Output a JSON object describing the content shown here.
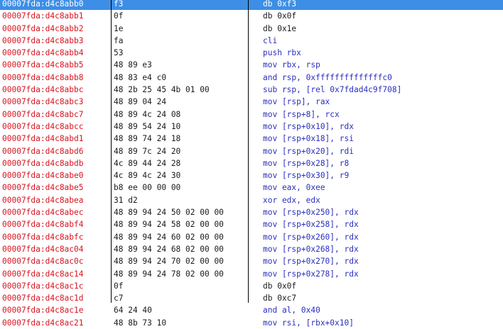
{
  "colors": {
    "address": "#d8131f",
    "bytes": "#1a1a1a",
    "instruction": "#2a2fbf",
    "data_directive": "#1a1a1a",
    "selection": "#3d8ee6"
  },
  "selected_index": 0,
  "rows": [
    {
      "address": "00007fda:d4c8abb0",
      "bytes": "f3",
      "instruction": "db 0xf3",
      "kind": "data"
    },
    {
      "address": "00007fda:d4c8abb1",
      "bytes": "0f",
      "instruction": "db 0x0f",
      "kind": "data"
    },
    {
      "address": "00007fda:d4c8abb2",
      "bytes": "1e",
      "instruction": "db 0x1e",
      "kind": "data"
    },
    {
      "address": "00007fda:d4c8abb3",
      "bytes": "fa",
      "instruction": "cli",
      "kind": "code"
    },
    {
      "address": "00007fda:d4c8abb4",
      "bytes": "53",
      "instruction": "push rbx",
      "kind": "code"
    },
    {
      "address": "00007fda:d4c8abb5",
      "bytes": "48 89 e3",
      "instruction": "mov rbx, rsp",
      "kind": "code"
    },
    {
      "address": "00007fda:d4c8abb8",
      "bytes": "48 83 e4 c0",
      "instruction": "and rsp, 0xffffffffffffffc0",
      "kind": "code"
    },
    {
      "address": "00007fda:d4c8abbc",
      "bytes": "48 2b 25 45 4b 01 00",
      "instruction": "sub rsp, [rel 0x7fdad4c9f708]",
      "kind": "code"
    },
    {
      "address": "00007fda:d4c8abc3",
      "bytes": "48 89 04 24",
      "instruction": "mov [rsp], rax",
      "kind": "code"
    },
    {
      "address": "00007fda:d4c8abc7",
      "bytes": "48 89 4c 24 08",
      "instruction": "mov [rsp+8], rcx",
      "kind": "code"
    },
    {
      "address": "00007fda:d4c8abcc",
      "bytes": "48 89 54 24 10",
      "instruction": "mov [rsp+0x10], rdx",
      "kind": "code"
    },
    {
      "address": "00007fda:d4c8abd1",
      "bytes": "48 89 74 24 18",
      "instruction": "mov [rsp+0x18], rsi",
      "kind": "code"
    },
    {
      "address": "00007fda:d4c8abd6",
      "bytes": "48 89 7c 24 20",
      "instruction": "mov [rsp+0x20], rdi",
      "kind": "code"
    },
    {
      "address": "00007fda:d4c8abdb",
      "bytes": "4c 89 44 24 28",
      "instruction": "mov [rsp+0x28], r8",
      "kind": "code"
    },
    {
      "address": "00007fda:d4c8abe0",
      "bytes": "4c 89 4c 24 30",
      "instruction": "mov [rsp+0x30], r9",
      "kind": "code"
    },
    {
      "address": "00007fda:d4c8abe5",
      "bytes": "b8 ee 00 00 00",
      "instruction": "mov eax, 0xee",
      "kind": "code"
    },
    {
      "address": "00007fda:d4c8abea",
      "bytes": "31 d2",
      "instruction": "xor edx, edx",
      "kind": "code"
    },
    {
      "address": "00007fda:d4c8abec",
      "bytes": "48 89 94 24 50 02 00 00",
      "instruction": "mov [rsp+0x250], rdx",
      "kind": "code"
    },
    {
      "address": "00007fda:d4c8abf4",
      "bytes": "48 89 94 24 58 02 00 00",
      "instruction": "mov [rsp+0x258], rdx",
      "kind": "code"
    },
    {
      "address": "00007fda:d4c8abfc",
      "bytes": "48 89 94 24 60 02 00 00",
      "instruction": "mov [rsp+0x260], rdx",
      "kind": "code"
    },
    {
      "address": "00007fda:d4c8ac04",
      "bytes": "48 89 94 24 68 02 00 00",
      "instruction": "mov [rsp+0x268], rdx",
      "kind": "code"
    },
    {
      "address": "00007fda:d4c8ac0c",
      "bytes": "48 89 94 24 70 02 00 00",
      "instruction": "mov [rsp+0x270], rdx",
      "kind": "code"
    },
    {
      "address": "00007fda:d4c8ac14",
      "bytes": "48 89 94 24 78 02 00 00",
      "instruction": "mov [rsp+0x278], rdx",
      "kind": "code"
    },
    {
      "address": "00007fda:d4c8ac1c",
      "bytes": "0f",
      "instruction": "db 0x0f",
      "kind": "data"
    },
    {
      "address": "00007fda:d4c8ac1d",
      "bytes": "c7",
      "instruction": "db 0xc7",
      "kind": "data"
    },
    {
      "address": "00007fda:d4c8ac1e",
      "bytes": "64 24 40",
      "instruction": "and al, 0x40",
      "kind": "code"
    },
    {
      "address": "00007fda:d4c8ac21",
      "bytes": "48 8b 73 10",
      "instruction": "mov rsi, [rbx+0x10]",
      "kind": "code"
    }
  ]
}
